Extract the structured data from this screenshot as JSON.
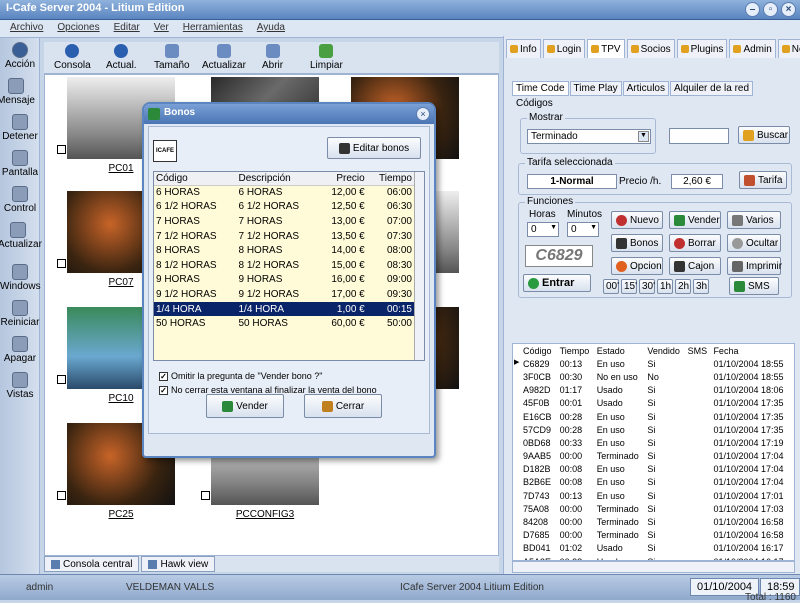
{
  "window": {
    "title": "I-Cafe Server 2004 - Litium Edition"
  },
  "menu": [
    "Archivo",
    "Opciones",
    "Editar",
    "Ver",
    "Herramientas",
    "Ayuda"
  ],
  "sidebar": [
    "Acción",
    "Mensaje",
    "Detener",
    "Pantalla",
    "Control",
    "Actualizar",
    "Windows",
    "Reiniciar",
    "Apagar",
    "Vistas"
  ],
  "toolbar": [
    "Consola",
    "Actual.",
    "Tamaño",
    "Actualizar",
    "Abrir",
    "Limpiar"
  ],
  "pcs": [
    {
      "label": "PC01"
    },
    {
      "label": "PC07"
    },
    {
      "label": "PC10"
    },
    {
      "label": "PC25"
    },
    {
      "label": "PCCONFIG3"
    }
  ],
  "bottom_tabs": [
    "Consola central",
    "Hawk view"
  ],
  "status": {
    "user": "admin",
    "company": "VELDEMAN VALLS",
    "product": "ICafe Server 2004 Litium Edition",
    "date": "01/10/2004",
    "time": "18:59"
  },
  "right_tabs": [
    "Info",
    "Login",
    "TPV",
    "Socios",
    "Plugins",
    "Admin",
    "News"
  ],
  "sub_tabs": [
    "Time Code",
    "Time Play",
    "Articulos",
    "Alquiler de la red"
  ],
  "codigos": {
    "caption": "Códigos",
    "mostrar_caption": "Mostrar",
    "mostrar_value": "Terminado",
    "buscar_label": "Buscar"
  },
  "tarifa": {
    "caption": "Tarifa seleccionada",
    "name": "1-Normal",
    "precio_label": "Precio /h.",
    "precio": "2,60 €",
    "button": "Tarifa"
  },
  "funciones": {
    "caption": "Funciones",
    "horas_label": "Horas",
    "minutos_label": "Minutos",
    "horas_value": "0",
    "minutos_value": "0",
    "code": "C6829",
    "buttons": [
      "Nuevo",
      "Vender",
      "Varios",
      "Bonos",
      "Borrar",
      "Ocultar",
      "Opcion",
      "Cajon",
      "Imprimir",
      "SMS"
    ],
    "entrar": "Entrar",
    "quick": [
      "00'",
      "15'",
      "30'",
      "1h",
      "2h",
      "3h"
    ]
  },
  "code_list": {
    "headers": [
      "Código",
      "Tiempo",
      "Estado",
      "Vendido",
      "SMS",
      "Fecha"
    ],
    "rows": [
      [
        "C6829",
        "00:13",
        "En uso",
        "Si",
        "",
        "01/10/2004 18:55"
      ],
      [
        "3F0CB",
        "00:30",
        "No en uso",
        "No",
        "",
        "01/10/2004 18:55"
      ],
      [
        "A982D",
        "01:17",
        "Usado",
        "Si",
        "",
        "01/10/2004 18:06"
      ],
      [
        "45F0B",
        "00:01",
        "Usado",
        "Si",
        "",
        "01/10/2004 17:35"
      ],
      [
        "E16CB",
        "00:28",
        "En uso",
        "Si",
        "",
        "01/10/2004 17:35"
      ],
      [
        "57CD9",
        "00:28",
        "En uso",
        "Si",
        "",
        "01/10/2004 17:35"
      ],
      [
        "0BD68",
        "00:33",
        "En uso",
        "Si",
        "",
        "01/10/2004 17:19"
      ],
      [
        "9AAB5",
        "00:00",
        "Terminado",
        "Si",
        "",
        "01/10/2004 17:04"
      ],
      [
        "D182B",
        "00:08",
        "En uso",
        "Si",
        "",
        "01/10/2004 17:04"
      ],
      [
        "B2B6E",
        "00:08",
        "En uso",
        "Si",
        "",
        "01/10/2004 17:04"
      ],
      [
        "7D743",
        "00:13",
        "En uso",
        "Si",
        "",
        "01/10/2004 17:01"
      ],
      [
        "75A08",
        "00:00",
        "Terminado",
        "Si",
        "",
        "01/10/2004 17:03"
      ],
      [
        "84208",
        "00:00",
        "Terminado",
        "Si",
        "",
        "01/10/2004 16:58"
      ],
      [
        "D7685",
        "00:00",
        "Terminado",
        "Si",
        "",
        "01/10/2004 16:58"
      ],
      [
        "BD041",
        "01:02",
        "Usado",
        "Si",
        "",
        "01/10/2004 16:17"
      ],
      [
        "A5A3E",
        "00:38",
        "Usado",
        "Si",
        "",
        "01/10/2004 16:17"
      ],
      [
        "1287F",
        "00:06",
        "En uso",
        "Si",
        "",
        "01/10/2004 16:17"
      ]
    ],
    "total": "Total : 1160"
  },
  "dialog": {
    "title": "Bonos",
    "logo": "ICAFE",
    "edit_button": "Editar bonos",
    "headers": [
      "Código",
      "Descripción",
      "Precio",
      "Tiempo"
    ],
    "rows": [
      [
        "6 HORAS",
        "6 HORAS",
        "12,00 €",
        "06:00"
      ],
      [
        "6 1/2 HORAS",
        "6 1/2 HORAS",
        "12,50 €",
        "06:30"
      ],
      [
        "7 HORAS",
        "7 HORAS",
        "13,00 €",
        "07:00"
      ],
      [
        "7 1/2 HORAS",
        "7 1/2 HORAS",
        "13,50 €",
        "07:30"
      ],
      [
        "8 HORAS",
        "8 HORAS",
        "14,00 €",
        "08:00"
      ],
      [
        "8 1/2 HORAS",
        "8 1/2 HORAS",
        "15,00 €",
        "08:30"
      ],
      [
        "9 HORAS",
        "9 HORAS",
        "16,00 €",
        "09:00"
      ],
      [
        "9 1/2 HORAS",
        "9 1/2 HORAS",
        "17,00 €",
        "09:30"
      ],
      [
        "1/4 HORA",
        "1/4 HORA",
        "1,00 €",
        "00:15"
      ],
      [
        "50 HORAS",
        "50 HORAS",
        "60,00 €",
        "50:00"
      ]
    ],
    "selected_row": 8,
    "check1": "Omitir la pregunta de \"Vender bono ?\"",
    "check2": "No cerrar esta ventana al finalizar la venta del bono",
    "sell_button": "Vender",
    "close_button": "Cerrar"
  }
}
